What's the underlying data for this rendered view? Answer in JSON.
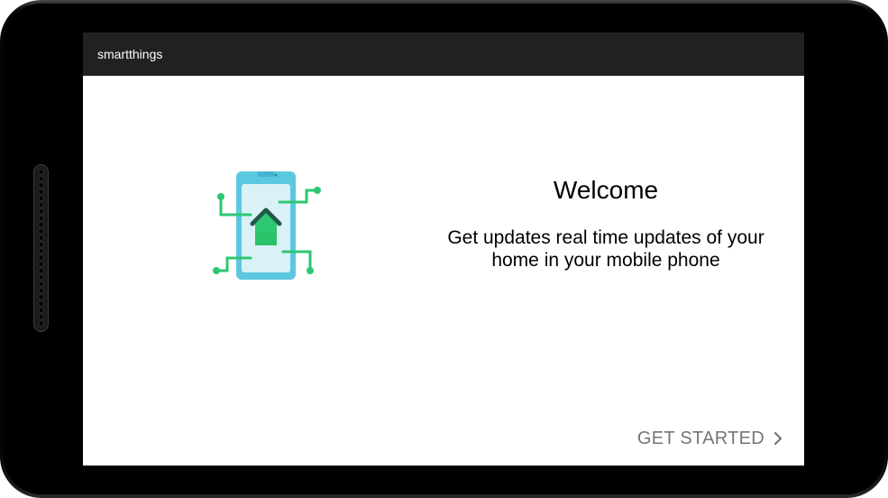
{
  "app": {
    "title": "smartthings"
  },
  "onboarding": {
    "illustration_icon": "smart-home-phone-icon",
    "title": "Welcome",
    "description": "Get updates real time updates of your home in your mobile phone",
    "cta_label": "GET STARTED",
    "cta_icon": "chevron-right-icon"
  },
  "colors": {
    "app_bar": "#212121",
    "background": "#ffffff",
    "phone_body": "#5bc8e0",
    "phone_screen": "#d9f1f7",
    "accent_green": "#2ec772",
    "house_outline": "#1e5a4a",
    "cta_text": "#757575"
  }
}
